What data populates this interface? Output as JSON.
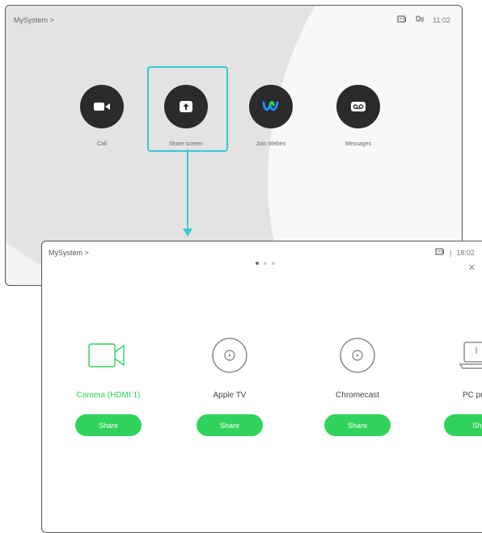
{
  "home": {
    "system_title": "MySystem >",
    "time": "11:02",
    "apps": [
      {
        "label": "Call",
        "icon": "video-camera-icon"
      },
      {
        "label": "Share screen",
        "icon": "share-screen-icon"
      },
      {
        "label": "Join Webex",
        "icon": "webex-icon"
      },
      {
        "label": "Messages",
        "icon": "voicemail-icon"
      }
    ],
    "status_icons": [
      "screen-status-icon",
      "mic-status-icon"
    ],
    "highlight_color": "#38c6d8"
  },
  "share_panel": {
    "system_title": "MySystem >",
    "separator": "|",
    "time": "18:02",
    "close": "×",
    "pager": {
      "pages": 3,
      "active": 0
    },
    "sources": [
      {
        "name": "Camera (HDMI 1)",
        "button": "Share",
        "icon": "hdmi-camera-icon",
        "active": true
      },
      {
        "name": "Apple TV",
        "button": "Share",
        "icon": "apple-tv-icon",
        "active": false
      },
      {
        "name": "Chromecast",
        "button": "Share",
        "icon": "chromecast-icon",
        "active": false
      },
      {
        "name": "PC pres",
        "button": "Sh",
        "icon": "laptop-icon",
        "active": false
      }
    ],
    "accent_color": "#2fd35b"
  }
}
